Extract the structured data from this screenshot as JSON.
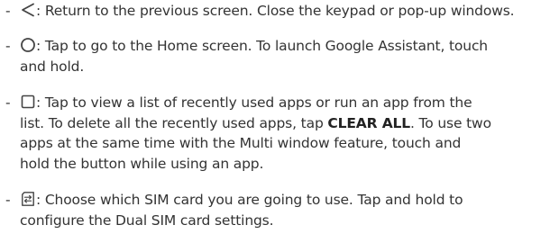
{
  "items": [
    {
      "bullet": "-",
      "icon": "back-triangle-icon",
      "lines": [
        ": Return to the previous screen. Close the keypad or pop-up windows."
      ]
    },
    {
      "bullet": "-",
      "icon": "home-circle-icon",
      "lines": [
        ": Tap to go to the Home screen. To launch Google Assistant, touch",
        "and hold."
      ]
    },
    {
      "bullet": "-",
      "icon": "recent-apps-square-icon",
      "lines": [
        ": Tap to view a list of recently used apps or run an app from the",
        "list. To delete all the recently used apps, tap ",
        "CLEAR ALL",
        ". To use two",
        "apps at the same time with the Multi window feature, touch and",
        "hold the button while using an app."
      ]
    },
    {
      "bullet": "-",
      "icon": "sim-switch-icon",
      "lines": [
        ": Choose which SIM card you are going to use. Tap and hold to",
        "configure the Dual SIM card settings."
      ]
    }
  ]
}
